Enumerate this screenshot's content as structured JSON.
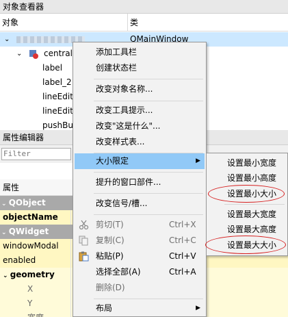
{
  "object_inspector": {
    "title": "对象查看器",
    "columns": {
      "object": "对象",
      "class": "类"
    },
    "rows": [
      {
        "name": "",
        "class": "QMainWindow",
        "selected": true
      },
      {
        "name": "central",
        "class": ""
      },
      {
        "name": "label",
        "class": ""
      },
      {
        "name": "label_2",
        "class": ""
      },
      {
        "name": "lineEdit",
        "class": ""
      },
      {
        "name": "lineEdit",
        "class": ""
      },
      {
        "name": "pushBu",
        "class": ""
      }
    ]
  },
  "property_editor": {
    "title": "属性编辑器",
    "filter_placeholder": "Filter",
    "header": "属性",
    "rows": [
      {
        "label": "QObject",
        "kind": "group"
      },
      {
        "label": "objectName",
        "kind": "yellow-bold"
      },
      {
        "label": "QWidget",
        "kind": "group"
      },
      {
        "label": "windowModal",
        "kind": "yellow"
      },
      {
        "label": "enabled",
        "kind": "yellow"
      },
      {
        "label": "geometry",
        "kind": "yellow2-bold"
      },
      {
        "label": "X",
        "kind": "sub"
      },
      {
        "label": "Y",
        "kind": "sub"
      },
      {
        "label": "宽度",
        "kind": "sub"
      }
    ]
  },
  "context_menu": {
    "items": [
      {
        "label": "添加工具栏"
      },
      {
        "label": "创建状态栏"
      },
      {
        "label": "改变对象名称..."
      },
      {
        "label": "改变工具提示..."
      },
      {
        "label": "改变\"这是什么\"..."
      },
      {
        "label": "改变样式表..."
      },
      {
        "label": "大小限定",
        "submenu": true,
        "active": true
      },
      {
        "label": "提升的窗口部件..."
      },
      {
        "label": "改变信号/槽..."
      },
      {
        "label": "剪切(T)",
        "shortcut": "Ctrl+X",
        "disabled": true,
        "icon": "scissors-icon"
      },
      {
        "label": "复制(C)",
        "shortcut": "Ctrl+C",
        "disabled": true,
        "icon": "copy-icon"
      },
      {
        "label": "粘贴(P)",
        "shortcut": "Ctrl+V",
        "icon": "paste-icon"
      },
      {
        "label": "选择全部(A)",
        "shortcut": "Ctrl+A"
      },
      {
        "label": "删除(D)",
        "disabled": true
      },
      {
        "label": "布局",
        "submenu": true
      }
    ]
  },
  "submenu": {
    "items": [
      {
        "label": "设置最小宽度"
      },
      {
        "label": "设置最小高度"
      },
      {
        "label": "设置最小大小",
        "circled": true
      },
      {
        "label": "设置最大宽度"
      },
      {
        "label": "设置最大高度"
      },
      {
        "label": "设置最大大小",
        "circled": true
      }
    ]
  },
  "colors": {
    "highlight": "#91c9f7",
    "selection": "#cce8ff",
    "annotation": "#d61e1e",
    "group": "#a9a9a9",
    "yellow": "#fff7c2"
  }
}
